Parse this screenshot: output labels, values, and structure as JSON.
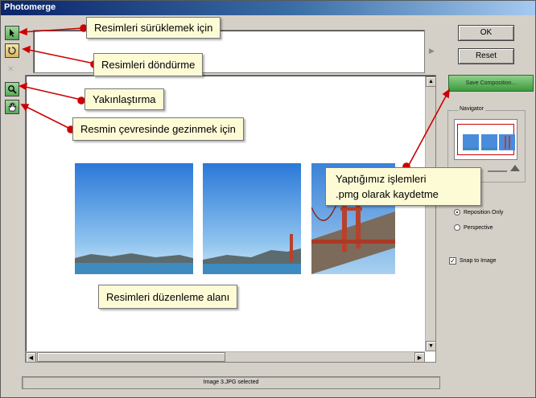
{
  "window": {
    "title": "Photomerge"
  },
  "tools": {
    "select": "arrow-pointer-icon",
    "rotate": "rotate-icon",
    "zoom": "magnifier-icon",
    "hand": "hand-icon"
  },
  "buttons": {
    "ok": "OK",
    "reset": "Reset",
    "save_composition": "Save Composition..."
  },
  "navigator": {
    "label": "Navigator"
  },
  "settings": {
    "reposition_only": "Reposition Only",
    "perspective": "Perspective",
    "snap_to_image": "Snap to Image",
    "selected_mode": "Reposition Only",
    "snap_checked": true
  },
  "status": {
    "text": "Image 3.JPG selected"
  },
  "annotations": {
    "drag": "Resimleri sürüklemek için",
    "rotate": "Resimleri döndürme",
    "zoom": "Yakınlaştırma",
    "pan": "Resmin çevresinde gezinmek için",
    "save_line1": "Yaptığımız işlemleri",
    "save_line2": ".pmg olarak kaydetme",
    "edit_area": "Resimleri düzenleme alanı"
  },
  "colors": {
    "title_bar": "#0a246a",
    "save_button": "#5aa85a",
    "callout_bg": "#fdfbd6",
    "annotation": "#cc0000"
  }
}
